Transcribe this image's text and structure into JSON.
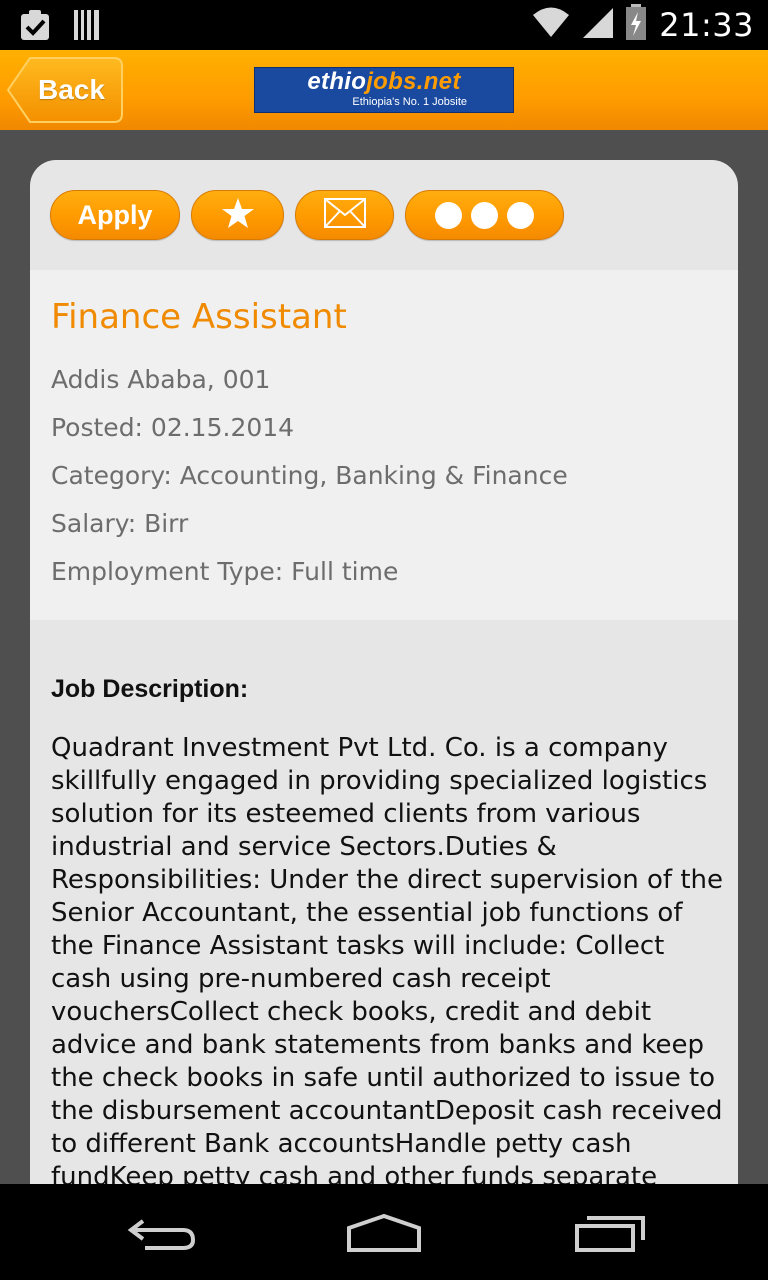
{
  "status_bar": {
    "time": "21:33",
    "icons": [
      "task-check-icon",
      "barcode-icon",
      "wifi-icon",
      "signal-icon",
      "battery-charging-icon"
    ]
  },
  "action_bar": {
    "back_label": "Back",
    "logo": {
      "part1": "ethio",
      "part2": "jobs.net",
      "tagline": "Ethiopia's No. 1 Jobsite"
    }
  },
  "actions": {
    "apply_label": "Apply",
    "icons": [
      "star-icon",
      "envelope-icon",
      "more-icon"
    ]
  },
  "job": {
    "title": "Finance Assistant",
    "location": "Addis Ababa, 001",
    "posted": "Posted: 02.15.2014",
    "category": "Category: Accounting, Banking & Finance",
    "salary": "Salary: Birr",
    "employment_type": "Employment Type: Full time"
  },
  "description": {
    "heading": "Job Description:",
    "text": "Quadrant Investment Pvt Ltd. Co. is a company skillfully engaged in providing specialized logistics solution for its esteemed clients from various industrial and service Sectors.Duties & Responsibilities: Under the direct supervision of the Senior Accountant, the essential job functions of the Finance Assistant tasks will include:  Collect cash using pre-numbered cash receipt vouchersCollect check books, credit and debit advice and bank statements from banks and keep the check books in safe until authorized to issue to the disbursement accountantDeposit cash received to different Bank accountsHandle petty cash fundKeep petty cash and other funds separate from other cash"
  },
  "nav_bar": {
    "icons": [
      "back-nav-icon",
      "home-nav-icon",
      "recents-nav-icon"
    ]
  },
  "colors": {
    "accent": "#ff9c00",
    "title": "#f08a00",
    "logo_bg": "#1a4aa0"
  }
}
